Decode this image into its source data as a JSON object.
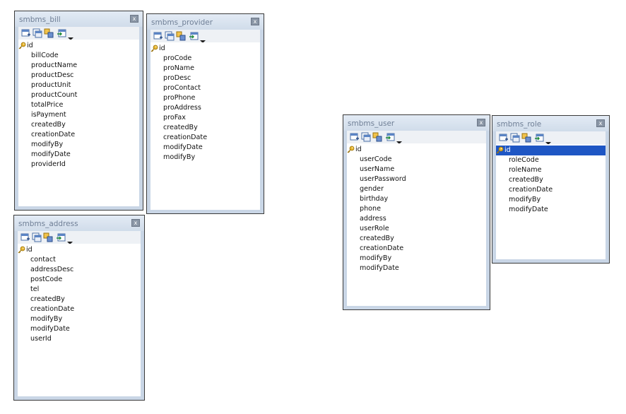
{
  "colors": {
    "window_border": "#3a3a3a",
    "window_frame": "#c9d6e6",
    "title_text": "#6f7f96",
    "selection": "#1e56c4",
    "key_icon": "#d9a21b"
  },
  "toolbar_icons": [
    "add-field-icon",
    "index-icon",
    "relation-icon",
    "navigate-icon",
    "dropdown-arrow-icon"
  ],
  "tables": [
    {
      "name": "smbms_bill",
      "close_label": "x",
      "primary_key": "id",
      "fields": [
        "billCode",
        "productName",
        "productDesc",
        "productUnit",
        "productCount",
        "totalPrice",
        "isPayment",
        "createdBy",
        "creationDate",
        "modifyBy",
        "modifyDate",
        "providerId"
      ]
    },
    {
      "name": "smbms_provider",
      "close_label": "x",
      "primary_key": "id",
      "fields": [
        "proCode",
        "proName",
        "proDesc",
        "proContact",
        "proPhone",
        "proAddress",
        "proFax",
        "createdBy",
        "creationDate",
        "modifyDate",
        "modifyBy"
      ]
    },
    {
      "name": "smbms_address",
      "close_label": "x",
      "primary_key": "id",
      "fields": [
        "contact",
        "addressDesc",
        "postCode",
        "tel",
        "createdBy",
        "creationDate",
        "modifyBy",
        "modifyDate",
        "userId"
      ]
    },
    {
      "name": "smbms_user",
      "close_label": "x",
      "primary_key": "id",
      "fields": [
        "userCode",
        "userName",
        "userPassword",
        "gender",
        "birthday",
        "phone",
        "address",
        "userRole",
        "createdBy",
        "creationDate",
        "modifyBy",
        "modifyDate"
      ]
    },
    {
      "name": "smbms_role",
      "close_label": "x",
      "primary_key": "id",
      "primary_key_selected": true,
      "fields": [
        "roleCode",
        "roleName",
        "createdBy",
        "creationDate",
        "modifyBy",
        "modifyDate"
      ]
    }
  ]
}
